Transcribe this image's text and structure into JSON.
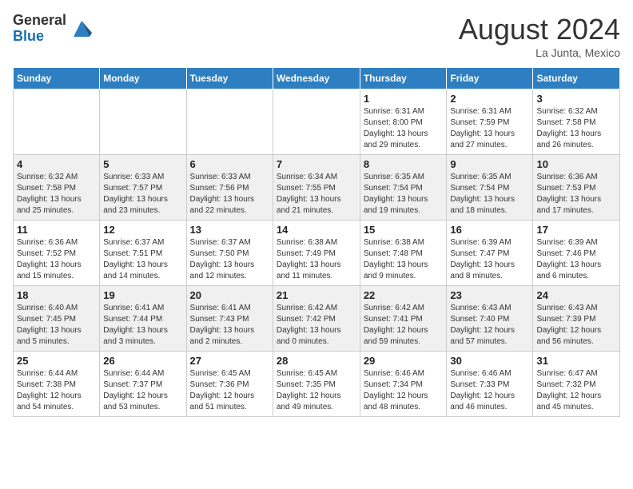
{
  "header": {
    "logo": {
      "general": "General",
      "blue": "Blue"
    },
    "title": "August 2024",
    "location": "La Junta, Mexico"
  },
  "calendar": {
    "days_of_week": [
      "Sunday",
      "Monday",
      "Tuesday",
      "Wednesday",
      "Thursday",
      "Friday",
      "Saturday"
    ],
    "weeks": [
      [
        {
          "day": "",
          "info": ""
        },
        {
          "day": "",
          "info": ""
        },
        {
          "day": "",
          "info": ""
        },
        {
          "day": "",
          "info": ""
        },
        {
          "day": "1",
          "info": "Sunrise: 6:31 AM\nSunset: 8:00 PM\nDaylight: 13 hours and 29 minutes."
        },
        {
          "day": "2",
          "info": "Sunrise: 6:31 AM\nSunset: 7:59 PM\nDaylight: 13 hours and 27 minutes."
        },
        {
          "day": "3",
          "info": "Sunrise: 6:32 AM\nSunset: 7:58 PM\nDaylight: 13 hours and 26 minutes."
        }
      ],
      [
        {
          "day": "4",
          "info": "Sunrise: 6:32 AM\nSunset: 7:58 PM\nDaylight: 13 hours and 25 minutes."
        },
        {
          "day": "5",
          "info": "Sunrise: 6:33 AM\nSunset: 7:57 PM\nDaylight: 13 hours and 23 minutes."
        },
        {
          "day": "6",
          "info": "Sunrise: 6:33 AM\nSunset: 7:56 PM\nDaylight: 13 hours and 22 minutes."
        },
        {
          "day": "7",
          "info": "Sunrise: 6:34 AM\nSunset: 7:55 PM\nDaylight: 13 hours and 21 minutes."
        },
        {
          "day": "8",
          "info": "Sunrise: 6:35 AM\nSunset: 7:54 PM\nDaylight: 13 hours and 19 minutes."
        },
        {
          "day": "9",
          "info": "Sunrise: 6:35 AM\nSunset: 7:54 PM\nDaylight: 13 hours and 18 minutes."
        },
        {
          "day": "10",
          "info": "Sunrise: 6:36 AM\nSunset: 7:53 PM\nDaylight: 13 hours and 17 minutes."
        }
      ],
      [
        {
          "day": "11",
          "info": "Sunrise: 6:36 AM\nSunset: 7:52 PM\nDaylight: 13 hours and 15 minutes."
        },
        {
          "day": "12",
          "info": "Sunrise: 6:37 AM\nSunset: 7:51 PM\nDaylight: 13 hours and 14 minutes."
        },
        {
          "day": "13",
          "info": "Sunrise: 6:37 AM\nSunset: 7:50 PM\nDaylight: 13 hours and 12 minutes."
        },
        {
          "day": "14",
          "info": "Sunrise: 6:38 AM\nSunset: 7:49 PM\nDaylight: 13 hours and 11 minutes."
        },
        {
          "day": "15",
          "info": "Sunrise: 6:38 AM\nSunset: 7:48 PM\nDaylight: 13 hours and 9 minutes."
        },
        {
          "day": "16",
          "info": "Sunrise: 6:39 AM\nSunset: 7:47 PM\nDaylight: 13 hours and 8 minutes."
        },
        {
          "day": "17",
          "info": "Sunrise: 6:39 AM\nSunset: 7:46 PM\nDaylight: 13 hours and 6 minutes."
        }
      ],
      [
        {
          "day": "18",
          "info": "Sunrise: 6:40 AM\nSunset: 7:45 PM\nDaylight: 13 hours and 5 minutes."
        },
        {
          "day": "19",
          "info": "Sunrise: 6:41 AM\nSunset: 7:44 PM\nDaylight: 13 hours and 3 minutes."
        },
        {
          "day": "20",
          "info": "Sunrise: 6:41 AM\nSunset: 7:43 PM\nDaylight: 13 hours and 2 minutes."
        },
        {
          "day": "21",
          "info": "Sunrise: 6:42 AM\nSunset: 7:42 PM\nDaylight: 13 hours and 0 minutes."
        },
        {
          "day": "22",
          "info": "Sunrise: 6:42 AM\nSunset: 7:41 PM\nDaylight: 12 hours and 59 minutes."
        },
        {
          "day": "23",
          "info": "Sunrise: 6:43 AM\nSunset: 7:40 PM\nDaylight: 12 hours and 57 minutes."
        },
        {
          "day": "24",
          "info": "Sunrise: 6:43 AM\nSunset: 7:39 PM\nDaylight: 12 hours and 56 minutes."
        }
      ],
      [
        {
          "day": "25",
          "info": "Sunrise: 6:44 AM\nSunset: 7:38 PM\nDaylight: 12 hours and 54 minutes."
        },
        {
          "day": "26",
          "info": "Sunrise: 6:44 AM\nSunset: 7:37 PM\nDaylight: 12 hours and 53 minutes."
        },
        {
          "day": "27",
          "info": "Sunrise: 6:45 AM\nSunset: 7:36 PM\nDaylight: 12 hours and 51 minutes."
        },
        {
          "day": "28",
          "info": "Sunrise: 6:45 AM\nSunset: 7:35 PM\nDaylight: 12 hours and 49 minutes."
        },
        {
          "day": "29",
          "info": "Sunrise: 6:46 AM\nSunset: 7:34 PM\nDaylight: 12 hours and 48 minutes."
        },
        {
          "day": "30",
          "info": "Sunrise: 6:46 AM\nSunset: 7:33 PM\nDaylight: 12 hours and 46 minutes."
        },
        {
          "day": "31",
          "info": "Sunrise: 6:47 AM\nSunset: 7:32 PM\nDaylight: 12 hours and 45 minutes."
        }
      ]
    ]
  }
}
